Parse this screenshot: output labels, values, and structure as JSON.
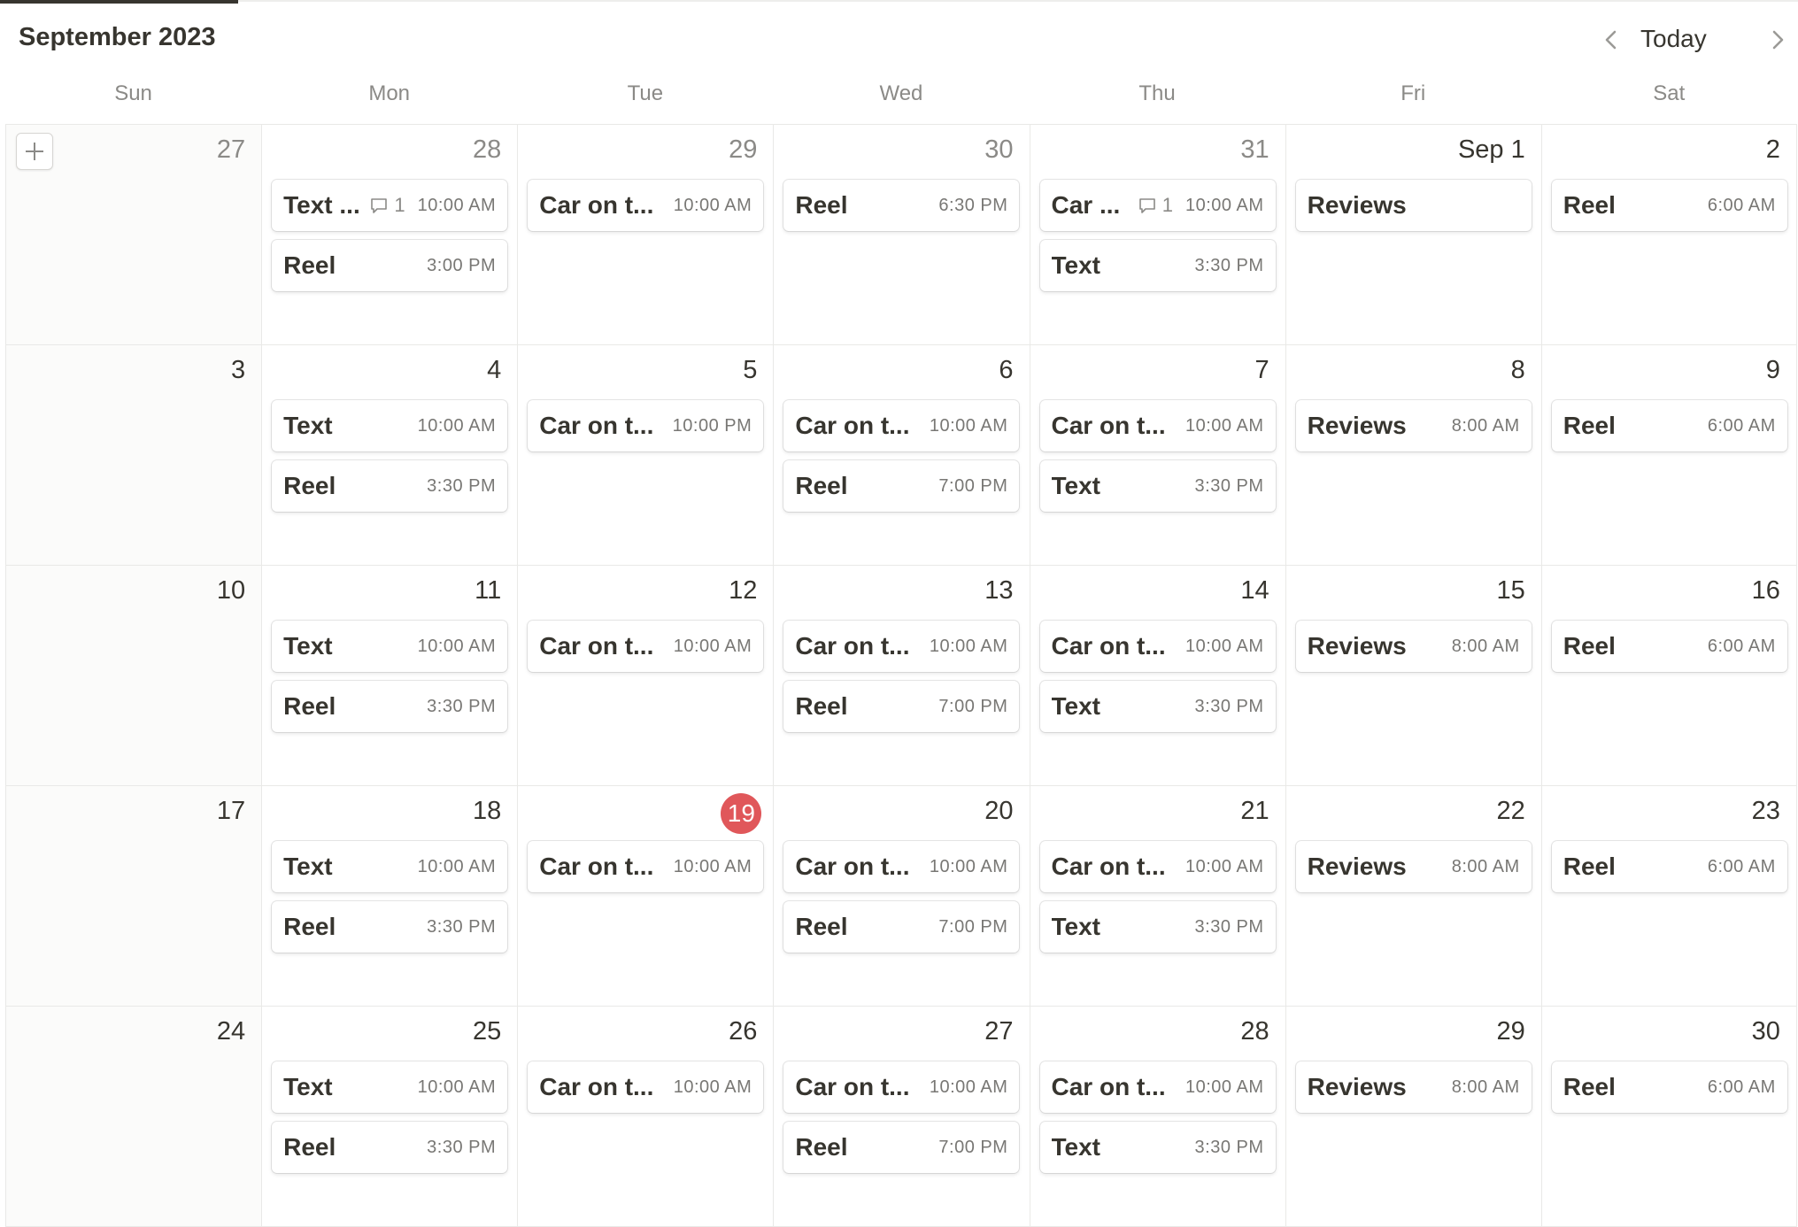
{
  "header": {
    "month_title": "September 2023",
    "today_label": "Today",
    "prev_icon": "chevron-left-icon",
    "next_icon": "chevron-right-icon"
  },
  "weekdays": [
    "Sun",
    "Mon",
    "Tue",
    "Wed",
    "Thu",
    "Fri",
    "Sat"
  ],
  "colors": {
    "today_badge": "#e0575a",
    "text": "#37352f",
    "muted": "#8b8a87"
  },
  "add_icon": "plus-icon",
  "weeks": [
    [
      {
        "label": "27",
        "other": true,
        "add": true,
        "events": []
      },
      {
        "label": "28",
        "other": true,
        "events": [
          {
            "title": "Text ...",
            "comments": "1",
            "time": "10:00 AM"
          },
          {
            "title": "Reel",
            "time": "3:00 PM"
          }
        ]
      },
      {
        "label": "29",
        "other": true,
        "events": [
          {
            "title": "Car on t...",
            "time": "10:00 AM"
          }
        ]
      },
      {
        "label": "30",
        "other": true,
        "events": [
          {
            "title": "Reel",
            "time": "6:30 PM"
          }
        ]
      },
      {
        "label": "31",
        "other": true,
        "events": [
          {
            "title": "Car ...",
            "comments": "1",
            "time": "10:00 AM"
          },
          {
            "title": "Text",
            "time": "3:30 PM"
          }
        ]
      },
      {
        "label": "Sep 1",
        "events": [
          {
            "title": "Reviews",
            "time": ""
          }
        ]
      },
      {
        "label": "2",
        "events": [
          {
            "title": "Reel",
            "time": "6:00 AM"
          }
        ]
      }
    ],
    [
      {
        "label": "3",
        "events": []
      },
      {
        "label": "4",
        "events": [
          {
            "title": "Text",
            "time": "10:00 AM"
          },
          {
            "title": "Reel",
            "time": "3:30 PM"
          }
        ]
      },
      {
        "label": "5",
        "events": [
          {
            "title": "Car on t...",
            "time": "10:00 PM"
          }
        ]
      },
      {
        "label": "6",
        "events": [
          {
            "title": "Car on t...",
            "time": "10:00 AM"
          },
          {
            "title": "Reel",
            "time": "7:00 PM"
          }
        ]
      },
      {
        "label": "7",
        "events": [
          {
            "title": "Car on t...",
            "time": "10:00 AM"
          },
          {
            "title": "Text",
            "time": "3:30 PM"
          }
        ]
      },
      {
        "label": "8",
        "events": [
          {
            "title": "Reviews",
            "time": "8:00 AM"
          }
        ]
      },
      {
        "label": "9",
        "events": [
          {
            "title": "Reel",
            "time": "6:00 AM"
          }
        ]
      }
    ],
    [
      {
        "label": "10",
        "events": []
      },
      {
        "label": "11",
        "events": [
          {
            "title": "Text",
            "time": "10:00 AM"
          },
          {
            "title": "Reel",
            "time": "3:30 PM"
          }
        ]
      },
      {
        "label": "12",
        "events": [
          {
            "title": "Car on t...",
            "time": "10:00 AM"
          }
        ]
      },
      {
        "label": "13",
        "events": [
          {
            "title": "Car on t...",
            "time": "10:00 AM"
          },
          {
            "title": "Reel",
            "time": "7:00 PM"
          }
        ]
      },
      {
        "label": "14",
        "events": [
          {
            "title": "Car on t...",
            "time": "10:00 AM"
          },
          {
            "title": "Text",
            "time": "3:30 PM"
          }
        ]
      },
      {
        "label": "15",
        "events": [
          {
            "title": "Reviews",
            "time": "8:00 AM"
          }
        ]
      },
      {
        "label": "16",
        "events": [
          {
            "title": "Reel",
            "time": "6:00 AM"
          }
        ]
      }
    ],
    [
      {
        "label": "17",
        "events": []
      },
      {
        "label": "18",
        "events": [
          {
            "title": "Text",
            "time": "10:00 AM"
          },
          {
            "title": "Reel",
            "time": "3:30 PM"
          }
        ]
      },
      {
        "label": "19",
        "today": true,
        "events": [
          {
            "title": "Car on t...",
            "time": "10:00 AM"
          }
        ]
      },
      {
        "label": "20",
        "events": [
          {
            "title": "Car on t...",
            "time": "10:00 AM"
          },
          {
            "title": "Reel",
            "time": "7:00 PM"
          }
        ]
      },
      {
        "label": "21",
        "events": [
          {
            "title": "Car on t...",
            "time": "10:00 AM"
          },
          {
            "title": "Text",
            "time": "3:30 PM"
          }
        ]
      },
      {
        "label": "22",
        "events": [
          {
            "title": "Reviews",
            "time": "8:00 AM"
          }
        ]
      },
      {
        "label": "23",
        "events": [
          {
            "title": "Reel",
            "time": "6:00 AM"
          }
        ]
      }
    ],
    [
      {
        "label": "24",
        "events": []
      },
      {
        "label": "25",
        "events": [
          {
            "title": "Text",
            "time": "10:00 AM"
          },
          {
            "title": "Reel",
            "time": "3:30 PM"
          }
        ]
      },
      {
        "label": "26",
        "events": [
          {
            "title": "Car on t...",
            "time": "10:00 AM"
          }
        ]
      },
      {
        "label": "27",
        "events": [
          {
            "title": "Car on t...",
            "time": "10:00 AM"
          },
          {
            "title": "Reel",
            "time": "7:00 PM"
          }
        ]
      },
      {
        "label": "28",
        "events": [
          {
            "title": "Car on t...",
            "time": "10:00 AM"
          },
          {
            "title": "Text",
            "time": "3:30 PM"
          }
        ]
      },
      {
        "label": "29",
        "events": [
          {
            "title": "Reviews",
            "time": "8:00 AM"
          }
        ]
      },
      {
        "label": "30",
        "events": [
          {
            "title": "Reel",
            "time": "6:00 AM"
          }
        ]
      }
    ]
  ]
}
